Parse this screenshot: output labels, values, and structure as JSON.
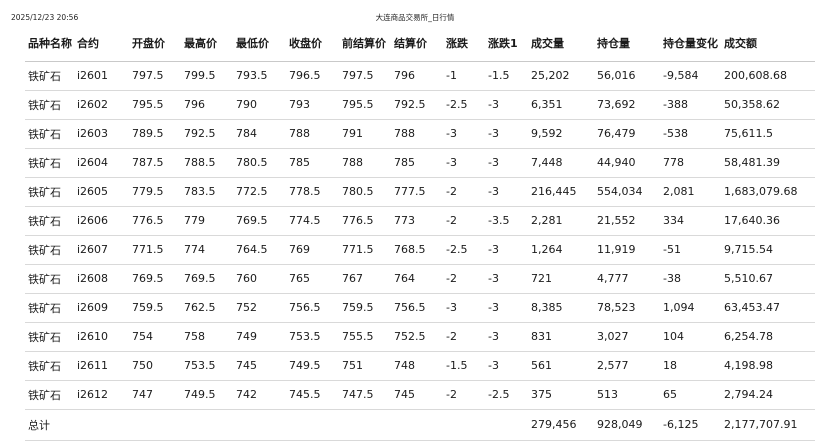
{
  "header": {
    "timestamp": "2025/12/23 20:56",
    "title": "大连商品交易所_日行情"
  },
  "table": {
    "columns": [
      "品种名称",
      "合约",
      "开盘价",
      "最高价",
      "最低价",
      "收盘价",
      "前结算价",
      "结算价",
      "涨跌",
      "涨跌1",
      "成交量",
      "持仓量",
      "持仓量变化",
      "成交额"
    ],
    "rows": [
      [
        "铁矿石",
        "i2601",
        "797.5",
        "799.5",
        "793.5",
        "796.5",
        "797.5",
        "796",
        "-1",
        "-1.5",
        "25,202",
        "56,016",
        "-9,584",
        "200,608.68"
      ],
      [
        "铁矿石",
        "i2602",
        "795.5",
        "796",
        "790",
        "793",
        "795.5",
        "792.5",
        "-2.5",
        "-3",
        "6,351",
        "73,692",
        "-388",
        "50,358.62"
      ],
      [
        "铁矿石",
        "i2603",
        "789.5",
        "792.5",
        "784",
        "788",
        "791",
        "788",
        "-3",
        "-3",
        "9,592",
        "76,479",
        "-538",
        "75,611.5"
      ],
      [
        "铁矿石",
        "i2604",
        "787.5",
        "788.5",
        "780.5",
        "785",
        "788",
        "785",
        "-3",
        "-3",
        "7,448",
        "44,940",
        "778",
        "58,481.39"
      ],
      [
        "铁矿石",
        "i2605",
        "779.5",
        "783.5",
        "772.5",
        "778.5",
        "780.5",
        "777.5",
        "-2",
        "-3",
        "216,445",
        "554,034",
        "2,081",
        "1,683,079.68"
      ],
      [
        "铁矿石",
        "i2606",
        "776.5",
        "779",
        "769.5",
        "774.5",
        "776.5",
        "773",
        "-2",
        "-3.5",
        "2,281",
        "21,552",
        "334",
        "17,640.36"
      ],
      [
        "铁矿石",
        "i2607",
        "771.5",
        "774",
        "764.5",
        "769",
        "771.5",
        "768.5",
        "-2.5",
        "-3",
        "1,264",
        "11,919",
        "-51",
        "9,715.54"
      ],
      [
        "铁矿石",
        "i2608",
        "769.5",
        "769.5",
        "760",
        "765",
        "767",
        "764",
        "-2",
        "-3",
        "721",
        "4,777",
        "-38",
        "5,510.67"
      ],
      [
        "铁矿石",
        "i2609",
        "759.5",
        "762.5",
        "752",
        "756.5",
        "759.5",
        "756.5",
        "-3",
        "-3",
        "8,385",
        "78,523",
        "1,094",
        "63,453.47"
      ],
      [
        "铁矿石",
        "i2610",
        "754",
        "758",
        "749",
        "753.5",
        "755.5",
        "752.5",
        "-2",
        "-3",
        "831",
        "3,027",
        "104",
        "6,254.78"
      ],
      [
        "铁矿石",
        "i2611",
        "750",
        "753.5",
        "745",
        "749.5",
        "751",
        "748",
        "-1.5",
        "-3",
        "561",
        "2,577",
        "18",
        "4,198.98"
      ],
      [
        "铁矿石",
        "i2612",
        "747",
        "749.5",
        "742",
        "745.5",
        "747.5",
        "745",
        "-2",
        "-2.5",
        "375",
        "513",
        "65",
        "2,794.24"
      ]
    ],
    "total_row": [
      "总计",
      "",
      "",
      "",
      "",
      "",
      "",
      "",
      "",
      "",
      "279,456",
      "928,049",
      "-6,125",
      "2,177,707.91"
    ]
  }
}
